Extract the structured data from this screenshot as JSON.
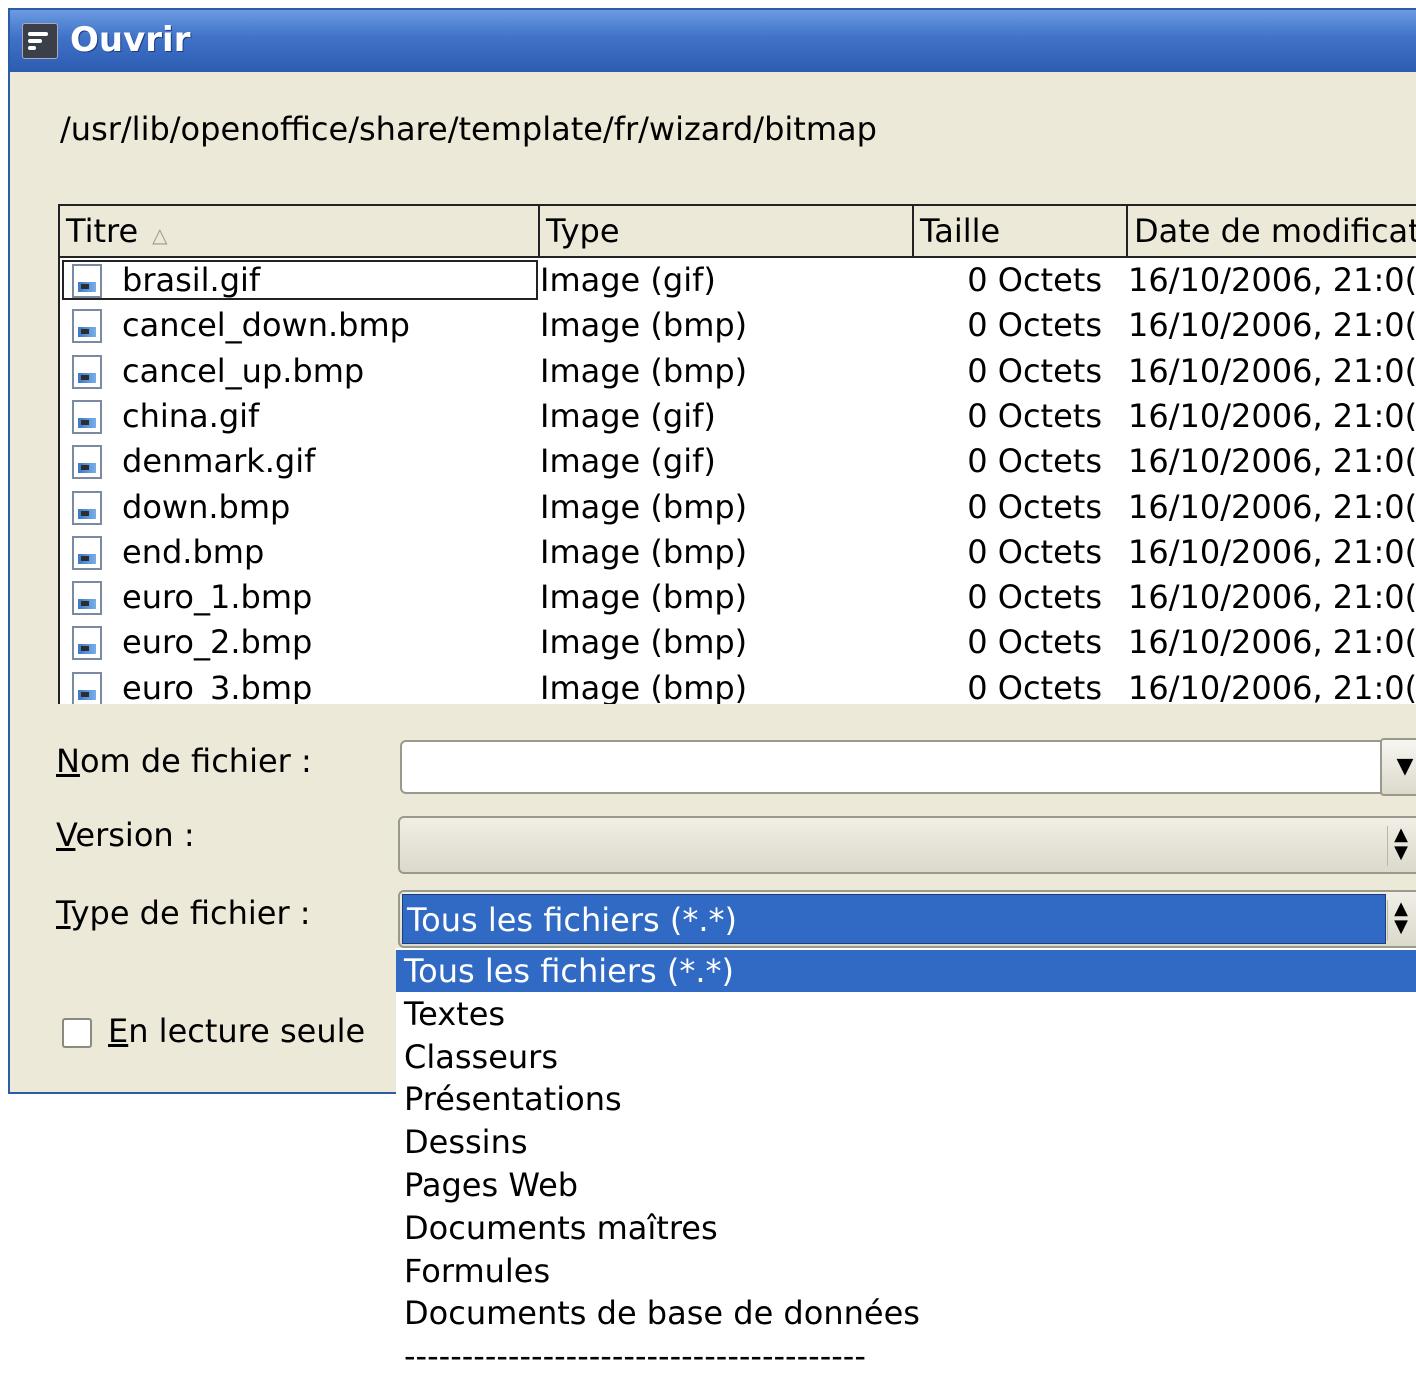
{
  "window": {
    "title": "Ouvrir",
    "path": "/usr/lib/openoffice/share/template/fr/wizard/bitmap"
  },
  "file_list": {
    "columns": [
      "Titre",
      "Type",
      "Taille",
      "Date de modificat"
    ],
    "sort_indicator": "△",
    "rows": [
      {
        "name": "brasil.gif",
        "type": "Image (gif)",
        "size": "0 Octets",
        "date": "16/10/2006, 21:0("
      },
      {
        "name": "cancel_down.bmp",
        "type": "Image (bmp)",
        "size": "0 Octets",
        "date": "16/10/2006, 21:0("
      },
      {
        "name": "cancel_up.bmp",
        "type": "Image (bmp)",
        "size": "0 Octets",
        "date": "16/10/2006, 21:0("
      },
      {
        "name": "china.gif",
        "type": "Image (gif)",
        "size": "0 Octets",
        "date": "16/10/2006, 21:0("
      },
      {
        "name": "denmark.gif",
        "type": "Image (gif)",
        "size": "0 Octets",
        "date": "16/10/2006, 21:0("
      },
      {
        "name": "down.bmp",
        "type": "Image (bmp)",
        "size": "0 Octets",
        "date": "16/10/2006, 21:0("
      },
      {
        "name": "end.bmp",
        "type": "Image (bmp)",
        "size": "0 Octets",
        "date": "16/10/2006, 21:0("
      },
      {
        "name": "euro_1.bmp",
        "type": "Image (bmp)",
        "size": "0 Octets",
        "date": "16/10/2006, 21:0("
      },
      {
        "name": "euro_2.bmp",
        "type": "Image (bmp)",
        "size": "0 Octets",
        "date": "16/10/2006, 21:0("
      },
      {
        "name": "euro_3.bmp",
        "type": "Image (bmp)",
        "size": "0 Octets",
        "date": "16/10/2006, 21:0("
      }
    ]
  },
  "form": {
    "filename": {
      "mnemonic": "N",
      "label_rest": "om de fichier :",
      "value": ""
    },
    "version": {
      "mnemonic": "V",
      "label_rest": "ersion :",
      "value": ""
    },
    "filetype": {
      "mnemonic": "T",
      "label_rest": "ype de fichier :",
      "value": "Tous les fichiers (*.*)"
    },
    "readonly": {
      "mnemonic": "E",
      "label_rest": "n lecture seule",
      "checked": false
    }
  },
  "filetype_options": [
    "Tous les fichiers (*.*)",
    "Textes",
    "Classeurs",
    "Présentations",
    "Dessins",
    "Pages Web",
    "Documents maîtres",
    "Formules",
    "Documents de base de données",
    "----------------------------------------"
  ],
  "colors": {
    "titlebar": "#3f72c8",
    "selection": "#316ac5",
    "dialog_bg": "#ece9d8"
  }
}
